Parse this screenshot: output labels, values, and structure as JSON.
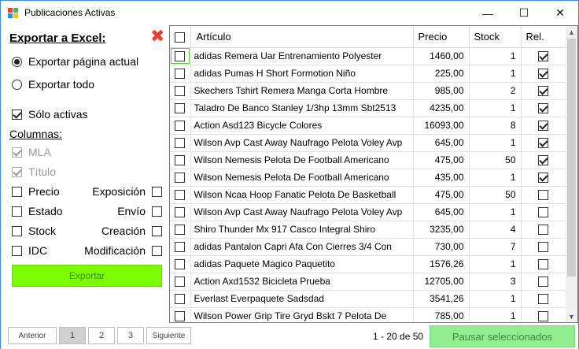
{
  "window": {
    "title": "Publicaciones Activas",
    "controls": {
      "minimize": "—",
      "maximize": "☐",
      "close": "✕"
    },
    "icon_colors": [
      "#e8402a",
      "#4caf50",
      "#2196f3",
      "#ffc107"
    ]
  },
  "export_panel": {
    "title": "Exportar a Excel:",
    "close_icon": "✖",
    "radio_current": "Exportar página actual",
    "radio_all": "Exportar todo",
    "radio_selected": "current",
    "only_active": "Sólo activas",
    "only_active_checked": true,
    "columns_label": "Columnas:",
    "col_mla": "MLA",
    "col_titulo": "Título",
    "col_precio": "Precio",
    "col_estado": "Estado",
    "col_stock": "Stock",
    "col_idc": "IDC",
    "col_exposicion": "Exposición",
    "col_envio": "Envío",
    "col_creacion": "Creación",
    "col_modificacion": "Modificación",
    "export_button": "Exportar",
    "export_button_color": "#7cfc00"
  },
  "grid": {
    "headers": {
      "articulo": "Artículo",
      "precio": "Precio",
      "stock": "Stock",
      "rel": "Rel."
    },
    "rows": [
      {
        "articulo": "adidas Remera Uar Entrenamiento Polyester",
        "precio": "1460,00",
        "stock": "1",
        "rel": true
      },
      {
        "articulo": "adidas Pumas H Short Formotion Niño",
        "precio": "225,00",
        "stock": "1",
        "rel": true
      },
      {
        "articulo": "Skechers Tshirt Remera Manga Corta Hombre",
        "precio": "985,00",
        "stock": "2",
        "rel": true
      },
      {
        "articulo": "Taladro De Banco Stanley 1/3hp 13mm Sbt2513",
        "precio": "4235,00",
        "stock": "1",
        "rel": true
      },
      {
        "articulo": "Action Asd123 Bicycle Colores",
        "precio": "16093,00",
        "stock": "8",
        "rel": true
      },
      {
        "articulo": "Wilson Avp Cast Away Naufrago Pelota Voley Avp",
        "precio": "645,00",
        "stock": "1",
        "rel": true
      },
      {
        "articulo": "Wilson Nemesis Pelota De Football Americano",
        "precio": "475,00",
        "stock": "50",
        "rel": true
      },
      {
        "articulo": "Wilson Nemesis Pelota De Football Americano",
        "precio": "435,00",
        "stock": "1",
        "rel": true
      },
      {
        "articulo": "Wilson Ncaa Hoop Fanatic Pelota De Basketball",
        "precio": "475,00",
        "stock": "50",
        "rel": false
      },
      {
        "articulo": "Wilson Avp Cast Away Naufrago Pelota Voley Avp",
        "precio": "645,00",
        "stock": "1",
        "rel": false
      },
      {
        "articulo": "Shiro Thunder Mx 917 Casco Integral Shiro",
        "precio": "3235,00",
        "stock": "4",
        "rel": false
      },
      {
        "articulo": "adidas Pantalon Capri Afa Con Cierres 3/4 Con",
        "precio": "730,00",
        "stock": "7",
        "rel": false
      },
      {
        "articulo": "adidas Paquete Magico Paquetito",
        "precio": "1576,26",
        "stock": "1",
        "rel": false
      },
      {
        "articulo": "Action Axd1532 Bicicleta Prueba",
        "precio": "12705,00",
        "stock": "3",
        "rel": false
      },
      {
        "articulo": "Everlast Everpaquete Sadsdad",
        "precio": "3541,26",
        "stock": "1",
        "rel": false
      },
      {
        "articulo": "Wilson Power Grip Tire Gryd Bskt 7 Pelota De",
        "precio": "785,00",
        "stock": "1",
        "rel": false
      }
    ]
  },
  "pager": {
    "prev": "Anterior",
    "pages": [
      "1",
      "2",
      "3"
    ],
    "current_page": "1",
    "next": "Siguiente",
    "range": "1 - 20 de 50",
    "pause_button": "Pausar seleccionados",
    "pause_button_color": "#90ee90"
  }
}
